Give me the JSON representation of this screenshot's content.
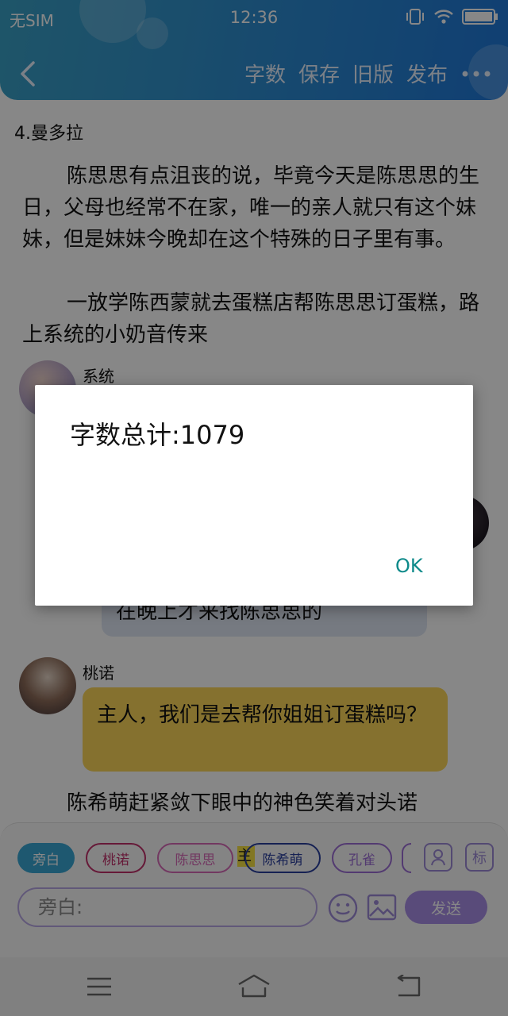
{
  "status_bar": {
    "carrier": "无SIM",
    "time": "12:36"
  },
  "toolbar": {
    "back_icon": "chevron-left-icon",
    "items": [
      "字数",
      "保存",
      "旧版",
      "发布"
    ],
    "more_icon": "more-dots-icon"
  },
  "content": {
    "chapter_title": "4.曼多拉",
    "paragraphs": [
      "陈思思有点沮丧的说，毕竟今天是陈思思的生日，父母也经常不在家，唯一的亲人就只有这个妹妹，但是妹妹今晚却在这个特殊的日子里有事。",
      "一放学陈西蒙就去蛋糕店帮陈思思订蛋糕，路上系统的小奶音传来",
      "陈希萌赶紧敛下眼中的神色笑着对头诺"
    ],
    "messages": [
      {
        "speaker": "系统"
      },
      {
        "text": "在晚上才来找陈思思的"
      },
      {
        "speaker": "桃诺",
        "text": "主人，我们是去帮你姐姐订蛋糕吗？"
      }
    ]
  },
  "input_panel": {
    "roles": [
      "旁白",
      "桃诺",
      "陈思思",
      "陈希萌",
      "孔雀"
    ],
    "role_note": "主",
    "placeholder": "旁白:",
    "send_label": "发送",
    "tag_label": "标",
    "icons": [
      "person-icon",
      "emoji-icon",
      "image-icon"
    ]
  },
  "dialog": {
    "message": "字数总计:1079",
    "ok_label": "OK"
  },
  "nav_icons": [
    "menu-icon",
    "home-icon",
    "back-icon"
  ],
  "colors": {
    "header": "#2f8fcf",
    "accent_teal": "#0e8a8a",
    "send": "#a98ee6",
    "user_bubble": "#fbd65a"
  }
}
